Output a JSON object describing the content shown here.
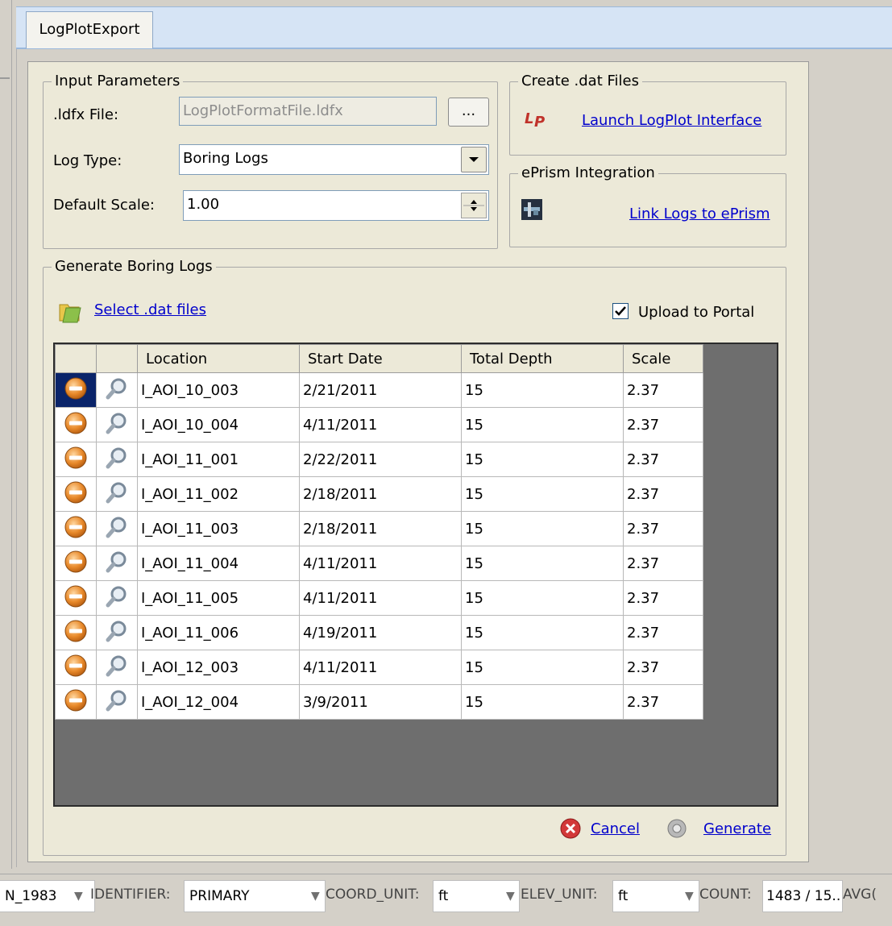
{
  "tab": {
    "label": "LogPlotExport"
  },
  "input_parameters": {
    "legend": "Input Parameters",
    "ldfx_label": ".ldfx File:",
    "ldfx_value": "LogPlotFormatFile.ldfx",
    "browse_label": "...",
    "log_type_label": "Log Type:",
    "log_type_value": "Boring Logs",
    "default_scale_label": "Default Scale:",
    "default_scale_value": "1.00"
  },
  "create_dat": {
    "legend": "Create .dat Files",
    "link": "Launch LogPlot Interface",
    "icon": "logplot-icon"
  },
  "eprism": {
    "legend": "ePrism Integration",
    "link": "Link Logs to ePrism",
    "icon": "eprism-icon"
  },
  "generate": {
    "legend": "Generate Boring Logs",
    "select_link": "Select .dat files",
    "upload_label": "Upload to Portal",
    "upload_checked": true,
    "columns": [
      "Location",
      "Start Date",
      "Total Depth",
      "Scale"
    ],
    "rows": [
      {
        "location": "I_AOI_10_003",
        "start_date": "2/21/2011",
        "total_depth": "15",
        "scale": "2.37"
      },
      {
        "location": "I_AOI_10_004",
        "start_date": "4/11/2011",
        "total_depth": "15",
        "scale": "2.37"
      },
      {
        "location": "I_AOI_11_001",
        "start_date": "2/22/2011",
        "total_depth": "15",
        "scale": "2.37"
      },
      {
        "location": "I_AOI_11_002",
        "start_date": "2/18/2011",
        "total_depth": "15",
        "scale": "2.37"
      },
      {
        "location": "I_AOI_11_003",
        "start_date": "2/18/2011",
        "total_depth": "15",
        "scale": "2.37"
      },
      {
        "location": "I_AOI_11_004",
        "start_date": "4/11/2011",
        "total_depth": "15",
        "scale": "2.37"
      },
      {
        "location": "I_AOI_11_005",
        "start_date": "4/11/2011",
        "total_depth": "15",
        "scale": "2.37"
      },
      {
        "location": "I_AOI_11_006",
        "start_date": "4/19/2011",
        "total_depth": "15",
        "scale": "2.37"
      },
      {
        "location": "I_AOI_12_003",
        "start_date": "4/11/2011",
        "total_depth": "15",
        "scale": "2.37"
      },
      {
        "location": "I_AOI_12_004",
        "start_date": "3/9/2011",
        "total_depth": "15",
        "scale": "2.37"
      }
    ],
    "cancel_label": "Cancel",
    "generate_label": "Generate"
  },
  "statusbar": {
    "datum_value": "N_1983",
    "identifier_label": "IDENTIFIER:",
    "identifier_value": "PRIMARY",
    "coord_unit_label": "COORD_UNIT:",
    "coord_unit_value": "ft",
    "elev_unit_label": "ELEV_UNIT:",
    "elev_unit_value": "ft",
    "count_label": "COUNT:",
    "count_value": "1483 / 15...",
    "avg_label": "AVG("
  },
  "colors": {
    "link": "#0000cc",
    "panel": "#ece9d8",
    "selection": "#0a246a",
    "tabbar": "#d6e4f5"
  }
}
